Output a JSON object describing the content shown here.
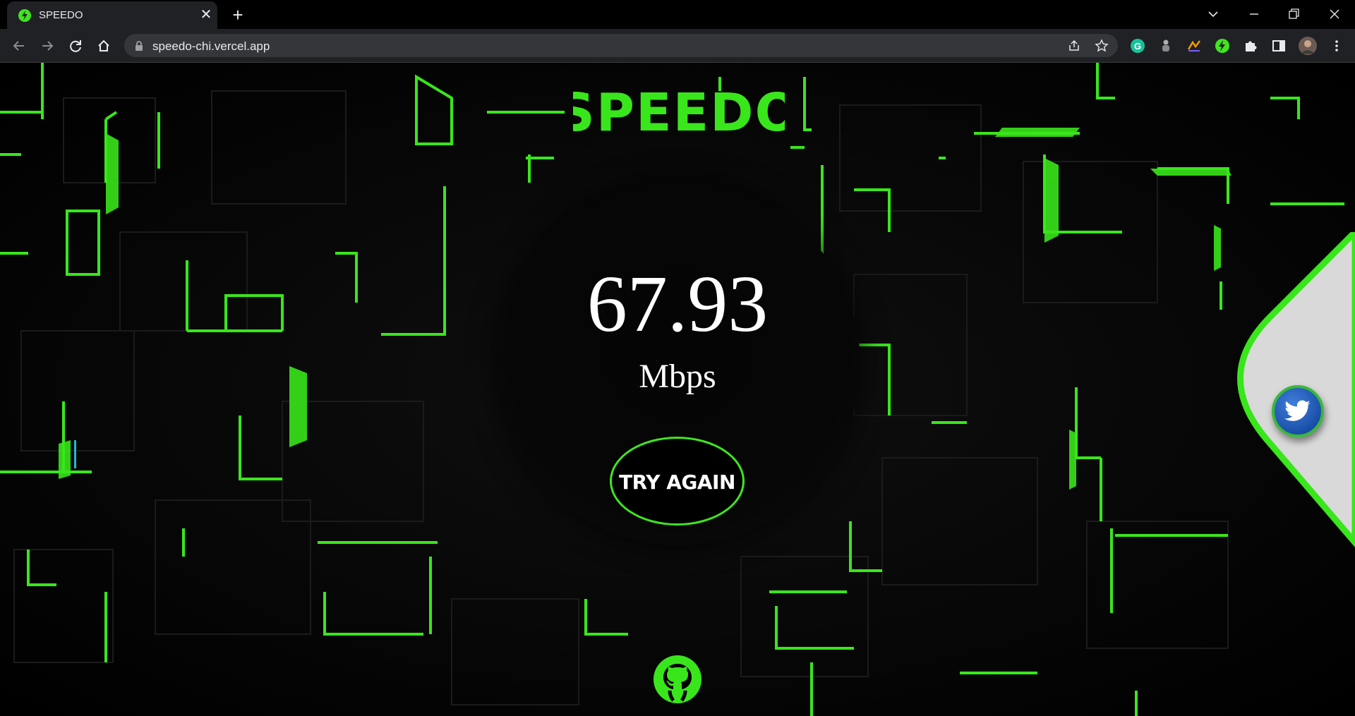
{
  "browser": {
    "tab_title": "SPEEDO",
    "url": "speedo-chi.vercel.app"
  },
  "page": {
    "logo_text": "SPEEDO",
    "speed_value": "67.93",
    "speed_unit": "Mbps",
    "try_again_label": "TRY AGAIN",
    "accent_color": "#39e61b"
  }
}
